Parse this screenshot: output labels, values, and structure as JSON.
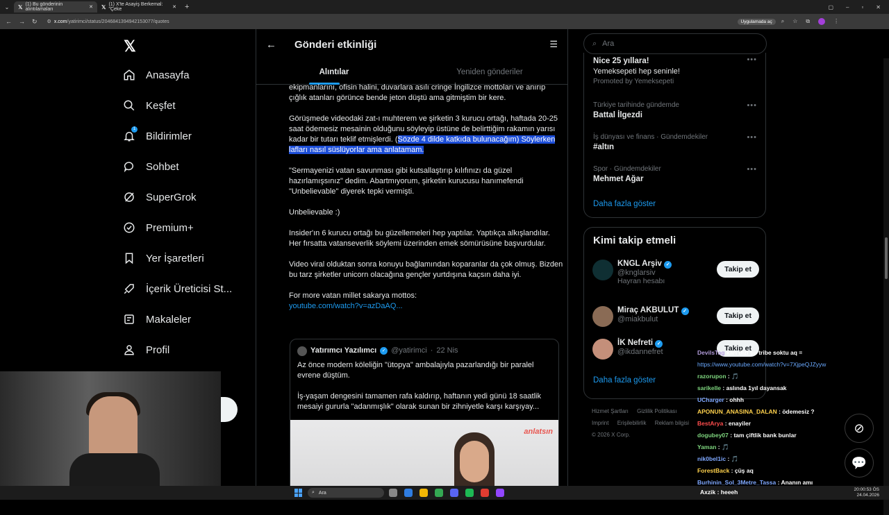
{
  "browser": {
    "tabs": [
      {
        "title": "(1) Bu gönderinin alıntılamaları",
        "active": true
      },
      {
        "title": "(1) X'te Asayiş Berkemal: \"Çeke",
        "active": false
      }
    ],
    "url_domain": "x.com",
    "url_path": "/yatirimci/status/2046841394942153077/quotes",
    "app_button": "Uygulamada aç"
  },
  "nav": {
    "items": [
      {
        "label": "Anasayfa",
        "icon": "home-icon"
      },
      {
        "label": "Keşfet",
        "icon": "search-icon"
      },
      {
        "label": "Bildirimler",
        "icon": "bell-icon",
        "badge": "1"
      },
      {
        "label": "Sohbet",
        "icon": "chat-icon"
      },
      {
        "label": "SuperGrok",
        "icon": "grok-icon"
      },
      {
        "label": "Premium+",
        "icon": "verified-icon"
      },
      {
        "label": "Yer İşaretleri",
        "icon": "bookmark-icon"
      },
      {
        "label": "İçerik Üreticisi St...",
        "icon": "rocket-icon"
      },
      {
        "label": "Makaleler",
        "icon": "article-icon"
      },
      {
        "label": "Profil",
        "icon": "person-icon"
      }
    ]
  },
  "header": {
    "title": "Gönderi etkinliği"
  },
  "tabs": {
    "quotes": "Alıntılar",
    "reposts": "Yeniden gönderiler"
  },
  "post": {
    "p1": "ekipmanlarını, ofisin halini, duvarlara asılı cringe İngilizce mottoları ve anırıp çığlık atanları görünce bende jeton düştü ama gitmiştim bir kere.",
    "p2_a": "Görüşmede videodaki zat-ı muhterem ve şirketin 3 kurucu ortağı, haftada 20-25 saat ödemesiz mesainin olduğunu söyleyip üstüne de belirttiğim rakamın yarısı kadar bir tutarı teklif etmişlerdi. (",
    "p2_hl": "Sözde 4 dilde katkıda bulunacağım) Söylerken lafları nasıl süslüyorlar ama anlatamam.",
    "p3": "\"Sermayenizi vatan savunması gibi kutsallaştırıp kılıfınızı da güzel hazırlamışsınız\" dedim. Abartmıyorum, şirketin kurucusu hanımefendi \"Unbelievable\" diyerek tepki vermişti.",
    "p4": "Unbelievable :)",
    "p5": "Insider'ın 6 kurucu ortağı bu güzellemeleri hep yaptılar. Yaptıkça alkışlandılar.\nHer fırsatta vatanseverlik söylemi üzerinden emek sömürüsüne başvurdular.",
    "p6": "Video viral olduktan sonra konuyu bağlamından koparanlar da çok olmuş. Bizden bu tarz şirketler unicorn olacağına gençler yurtdışına kaçsın daha iyi.",
    "p7": "For more vatan millet sakarya mottos:",
    "link": "youtube.com/watch?v=azDaAQ..."
  },
  "quote": {
    "name": "Yatırımcı Yazılımcı",
    "handle": "@yatirimci",
    "date": "22 Nis",
    "text1": "Az önce modern köleliğin \"ütopya\" ambalajıyla pazarlandığı bir paralel evrene düştüm.",
    "text2": "İş-yaşam dengesini tamamen rafa kaldırıp, haftanın yedi günü 18 saatlik mesaiyi gururla \"adanmışlık\" olarak sunan bir zihniyetle karşı karşıyay...",
    "image_logo": "anlatsın"
  },
  "search": {
    "placeholder": "Ara"
  },
  "trends": {
    "ad_title": "Nice 25 yıllara!",
    "ad_sub": "Yemeksepeti hep seninle!",
    "ad_promo": "Promoted by Yemeksepeti",
    "items": [
      {
        "label": "Türkiye tarihinde gündemde",
        "title": "Battal İlgezdi"
      },
      {
        "label": "İş dünyası ve finans · Gündemdekiler",
        "title": "#altın"
      },
      {
        "label": "Spor · Gündemdekiler",
        "title": "Mehmet Ağar"
      }
    ],
    "more": "Daha fazla göster"
  },
  "who_to_follow": {
    "title": "Kimi takip etmeli",
    "accounts": [
      {
        "name": "KNGL Arşiv",
        "handle": "@knglarsiv",
        "bio": "Hayran hesabı",
        "button": "Takip et"
      },
      {
        "name": "Miraç AKBULUT",
        "handle": "@miakbulut",
        "bio": "",
        "button": "Takip et"
      },
      {
        "name": "İK Nefreti",
        "handle": "@ikdannefret",
        "bio": "",
        "button": "Takip et"
      }
    ],
    "more": "Daha fazla göster"
  },
  "footer": {
    "links": [
      "Hizmet Şartları",
      "Gizlilik Politikası",
      "Imprint",
      "Erişilebilirlik",
      "Reklam bilgisi"
    ],
    "copyright": "© 2026 X Corp."
  },
  "chat": [
    {
      "user": "DevilsTag",
      "color": "#b39ddb",
      "msg": "karı bizi şu tribe soktu aq ="
    },
    {
      "user": "",
      "color": "#6aa9ff",
      "msg": "https://www.youtube.com/watch?v=7XjpeQJZyyw"
    },
    {
      "user": "razorupon",
      "color": "#7fd67f",
      "msg": "🎵"
    },
    {
      "user": "sarikelle",
      "color": "#7fd67f",
      "msg": "aslında 1yıl dayansak"
    },
    {
      "user": "UCharger",
      "color": "#7fa8ff",
      "msg": "ohhh"
    },
    {
      "user": "APONUN_ANASINA_DALAN",
      "color": "#ffd24d",
      "msg": "ödemesiz ?"
    },
    {
      "user": "BestArya",
      "color": "#ff4d4d",
      "msg": "enayiler"
    },
    {
      "user": "dogubey07",
      "color": "#7fd67f",
      "msg": "tam çiftlik bank bunlar"
    },
    {
      "user": "Yaman",
      "color": "#7fd67f",
      "msg": "🎵"
    },
    {
      "user": "nik0bel1ic",
      "color": "#7fa8ff",
      "msg": "🎵"
    },
    {
      "user": "ForestBack",
      "color": "#ffd24d",
      "msg": "çüş aq"
    },
    {
      "user": "Burhinin_Sol_3Metre_Tassa",
      "color": "#7fa8ff",
      "msg": "Ananın amı"
    },
    {
      "user": "Axzik",
      "color": "#ffffff",
      "msg": "heeeh"
    }
  ],
  "taskbar": {
    "search": "Ara",
    "time": "20:00:53 ÖS",
    "date": "24.04.2026"
  }
}
